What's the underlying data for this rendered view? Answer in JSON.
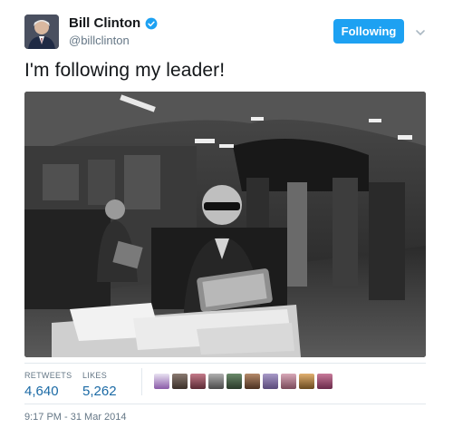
{
  "author": {
    "name": "Bill Clinton",
    "handle": "@billclinton",
    "verified": true
  },
  "follow_button": {
    "label": "Following",
    "color": "#1da1f2"
  },
  "tweet_text": "I'm following my leader!",
  "stats": {
    "retweets_label": "RETWEETS",
    "retweets_value": "4,640",
    "likes_label": "LIKES",
    "likes_value": "5,262"
  },
  "likers_count_shown": 10,
  "timestamp": "9:17 PM - 31 Mar 2014",
  "colors": {
    "accent": "#1da1f2",
    "stat_value": "#1b6aa5",
    "muted": "#657786"
  }
}
